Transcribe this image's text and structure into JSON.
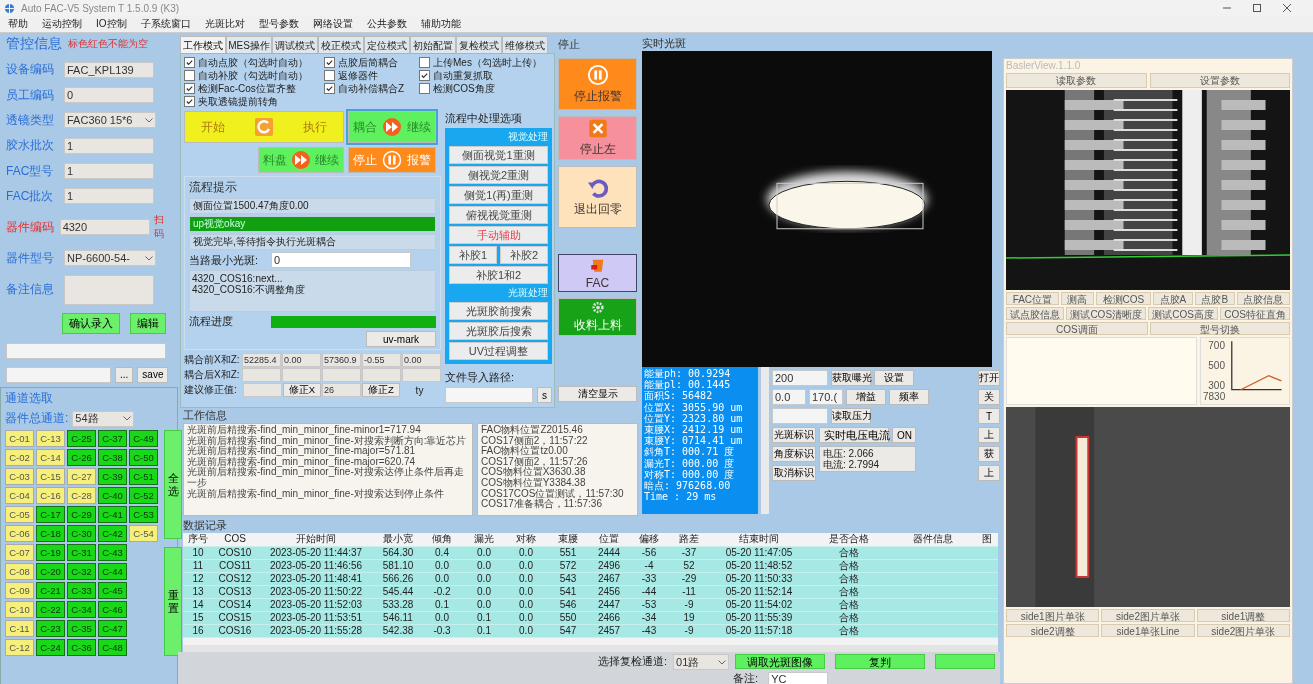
{
  "window": {
    "title": "Auto FAC-V5 System T 1.5.0.9 (K3)"
  },
  "menu": [
    "帮助",
    "运动控制",
    "IO控制",
    "子系统窗口",
    "光斑比对",
    "型号参数",
    "网络设置",
    "公共参数",
    "辅助功能"
  ],
  "left_panel": {
    "title": "管控信息",
    "note": "标色红色不能为空",
    "fields": [
      {
        "label": "设备编码",
        "kind": "text",
        "value": "FAC_KPL139",
        "required": false
      },
      {
        "label": "员工编码",
        "kind": "text",
        "value": "0",
        "required": false
      },
      {
        "label": "透镜类型",
        "kind": "combo",
        "value": "FAC360  15*6",
        "required": false
      },
      {
        "label": "胶水批次",
        "kind": "text",
        "value": "1",
        "required": false
      },
      {
        "label": "FAC型号",
        "kind": "text",
        "value": "1",
        "required": false
      },
      {
        "label": "FAC批次",
        "kind": "text",
        "value": "1",
        "required": false
      },
      {
        "label": "器件编码",
        "kind": "text",
        "value": "4320",
        "required": true,
        "link": "扫码"
      },
      {
        "label": "器件型号",
        "kind": "combo",
        "value": "NP-6600-54-",
        "required": false
      },
      {
        "label": "备注信息",
        "kind": "textarea",
        "required": false
      }
    ],
    "buttons": [
      "确认录入",
      "编辑"
    ],
    "path_buttons": [
      "...",
      "save"
    ]
  },
  "channel_panel": {
    "title": "通道选取",
    "total_label": "器件总通道:",
    "total_value": "54路",
    "channels": [
      {
        "label": "C-01",
        "selected": false
      },
      {
        "label": "C-02",
        "selected": false
      },
      {
        "label": "C-03",
        "selected": false
      },
      {
        "label": "C-04",
        "selected": false
      },
      {
        "label": "C-05",
        "selected": false
      },
      {
        "label": "C-06",
        "selected": false
      },
      {
        "label": "C-07",
        "selected": false
      },
      {
        "label": "C-08",
        "selected": false
      },
      {
        "label": "C-09",
        "selected": false
      },
      {
        "label": "C-10",
        "selected": false
      },
      {
        "label": "C-11",
        "selected": false
      },
      {
        "label": "C-12",
        "selected": false
      },
      {
        "label": "C-13",
        "selected": false
      },
      {
        "label": "C-14",
        "selected": false
      },
      {
        "label": "C-15",
        "selected": false
      },
      {
        "label": "C-16",
        "selected": false
      },
      {
        "label": "C-17",
        "selected": true
      },
      {
        "label": "C-18",
        "selected": true
      },
      {
        "label": "C-19",
        "selected": true
      },
      {
        "label": "C-20",
        "selected": true
      },
      {
        "label": "C-21",
        "selected": true
      },
      {
        "label": "C-22",
        "selected": true
      },
      {
        "label": "C-23",
        "selected": true
      },
      {
        "label": "C-24",
        "selected": true
      },
      {
        "label": "C-25",
        "selected": true
      },
      {
        "label": "C-26",
        "selected": true
      },
      {
        "label": "C-27",
        "selected": false
      },
      {
        "label": "C-28",
        "selected": false
      },
      {
        "label": "C-29",
        "selected": true
      },
      {
        "label": "C-30",
        "selected": true
      },
      {
        "label": "C-31",
        "selected": true
      },
      {
        "label": "C-32",
        "selected": true
      },
      {
        "label": "C-33",
        "selected": true
      },
      {
        "label": "C-34",
        "selected": true
      },
      {
        "label": "C-35",
        "selected": true
      },
      {
        "label": "C-36",
        "selected": true
      },
      {
        "label": "C-37",
        "selected": true
      },
      {
        "label": "C-38",
        "selected": true
      },
      {
        "label": "C-39",
        "selected": true
      },
      {
        "label": "C-40",
        "selected": true
      },
      {
        "label": "C-41",
        "selected": true
      },
      {
        "label": "C-42",
        "selected": true
      },
      {
        "label": "C-43",
        "selected": true
      },
      {
        "label": "C-44",
        "selected": true
      },
      {
        "label": "C-45",
        "selected": true
      },
      {
        "label": "C-46",
        "selected": true
      },
      {
        "label": "C-47",
        "selected": true
      },
      {
        "label": "C-48",
        "selected": true
      },
      {
        "label": "C-49",
        "selected": true
      },
      {
        "label": "C-50",
        "selected": true
      },
      {
        "label": "C-51",
        "selected": true
      },
      {
        "label": "C-52",
        "selected": true
      },
      {
        "label": "C-53",
        "selected": true
      },
      {
        "label": "C-54",
        "selected": false
      }
    ],
    "side_buttons": [
      "全选",
      "重置"
    ]
  },
  "mode_panel": {
    "tabs": [
      {
        "label": "工作模式",
        "selected": true
      },
      {
        "label": "MES操作",
        "selected": false
      },
      {
        "label": "调试模式",
        "selected": false
      },
      {
        "label": "校正模式",
        "selected": false
      },
      {
        "label": "定位模式",
        "selected": false
      },
      {
        "label": "初始配置",
        "selected": false
      },
      {
        "label": "复检模式",
        "selected": false
      },
      {
        "label": "维修模式",
        "selected": false
      }
    ],
    "checkbox_columns": [
      [
        {
          "label": "自动点胶（勾选时自动）",
          "checked": true
        },
        {
          "label": "自动补胶（勾选时自动）",
          "checked": false
        },
        {
          "label": "检测Fac-Cos位置齐整",
          "checked": true
        },
        {
          "label": "夹取透镜提前转角",
          "checked": true
        }
      ],
      [
        {
          "label": "点胶后简耦合",
          "checked": true
        },
        {
          "label": "返修器件",
          "checked": false
        },
        {
          "label": "自动补偿耦合Z",
          "checked": true
        }
      ],
      [
        {
          "label": "上传Mes（勾选时上传）",
          "checked": false
        },
        {
          "label": "自动重复抓取",
          "checked": true
        },
        {
          "label": "检测COS角度",
          "checked": false
        }
      ]
    ],
    "action_buttons": [
      {
        "left": "开始",
        "right": "执行",
        "color": "#f0f01e",
        "kind": "refresh"
      },
      {
        "left": "耦合",
        "right": "继续",
        "color": "#5ef05e",
        "kind": "forward"
      },
      {
        "left": "料盘",
        "right": "继续",
        "color": "#5ef05e",
        "kind": "forward"
      },
      {
        "left": "停止",
        "right": "报警",
        "color": "#ff8a1c",
        "kind": "pause"
      }
    ],
    "hints": {
      "title": "流程提示",
      "lines": [
        {
          "text": "侧面位置1500.47角度0.00",
          "kind": "normal"
        },
        {
          "text": "up视觉okay",
          "kind": "ok"
        },
        {
          "text": "视觉完毕,等待指令执行光斑耦合",
          "kind": "normal"
        }
      ],
      "min_spot_label": "当路最小光斑:",
      "min_spot_value": "0",
      "log": [
        "4320_COS16:next...",
        "4320_COS16:不调整角度"
      ],
      "progress_label": "流程进度",
      "progress": {
        "level": 1
      },
      "mark_button": "uv-mark"
    },
    "coupling": [
      {
        "label": "耦合前X和Z:",
        "cells": [
          {
            "kind": "field",
            "value": "52285.4"
          },
          {
            "kind": "field",
            "value": "0.00"
          },
          {
            "kind": "field",
            "value": "57360.9"
          },
          {
            "kind": "field",
            "value": "-0.55"
          },
          {
            "kind": "field",
            "value": "0.00"
          }
        ]
      },
      {
        "label": "耦合后X和Z:",
        "cells": [
          {
            "kind": "field"
          },
          {
            "kind": "field"
          },
          {
            "kind": "field"
          },
          {
            "kind": "field"
          },
          {
            "kind": "field"
          }
        ]
      },
      {
        "label": "建议修正值:",
        "cells": [
          {
            "kind": "field"
          },
          {
            "kind": "button",
            "value": "修正X"
          },
          {
            "kind": "field",
            "value": "26"
          },
          {
            "kind": "button",
            "value": "修正Z"
          },
          {
            "kind": "text",
            "value": "ty"
          }
        ]
      }
    ],
    "options": {
      "title": "流程中处理选项",
      "sections": [
        {
          "title": "视觉处理",
          "rows": [
            [
              {
                "label": "侧面视觉1重测",
                "kind": "normal"
              }
            ],
            [
              {
                "label": "侧视觉2重测",
                "kind": "normal"
              }
            ],
            [
              {
                "label": "侧觉1(再)重测",
                "kind": "normal"
              }
            ],
            [
              {
                "label": "俯视视觉重测",
                "kind": "normal"
              }
            ],
            [
              {
                "label": "手动辅助",
                "kind": "alert"
              }
            ],
            [
              {
                "label": "补胶1",
                "kind": "normal"
              },
              {
                "label": "补胶2",
                "kind": "normal"
              }
            ],
            [
              {
                "label": "补胶1和2",
                "kind": "normal"
              }
            ]
          ]
        },
        {
          "title": "光斑处理",
          "rows": [
            [
              {
                "label": "光斑胶前搜索",
                "kind": "normal"
              }
            ],
            [
              {
                "label": "光斑胶后搜索",
                "kind": "normal"
              }
            ],
            [
              {
                "label": "UV过程调整",
                "kind": "normal"
              }
            ]
          ]
        }
      ],
      "path_label": "文件导入路径:",
      "path_button": "s"
    }
  },
  "stop_panel": {
    "title": "停止",
    "buttons": [
      {
        "label": "停止报警",
        "color": "#ff8a1c",
        "kind": "pause"
      },
      {
        "label": "停止左",
        "color": "#f5909c",
        "kind": "cross"
      },
      {
        "label": "退出回零",
        "color": "#fde2bb",
        "kind": "undo"
      },
      {
        "label": "FAC",
        "color": "#cfcaf5",
        "kind": "bucket"
      },
      {
        "label": "收料上料",
        "color": "#17a317",
        "kind": "gear"
      }
    ],
    "clear_button": "清空显示"
  },
  "work_info": {
    "title": "工作信息",
    "log": [
      "光斑前后精搜索-find_min_minor_fine-minor1=717.94",
      "光斑前后精搜索-find_min_minor_fine-对搜索判断方向:靠近芯片",
      "光斑前后精搜索-find_min_minor_fine-major=571.81",
      "光斑前后精搜索-find_min_minor_fine-major=620.74",
      "光斑前后精搜索-find_min_minor_fine-对搜索达停止条件后再走一步",
      "光斑前后精搜索-find_min_minor_fine-对搜索达到停止条件"
    ],
    "status_log": [
      "FAC物料位置Z2015.46",
      "COS17侧面2，11:57:22",
      "FAC物料位置tz0.00",
      "COS17侧面2，11:57:26",
      "COS物料位置X3630.38",
      "COS物料位置Y3384.38",
      "COS17COS位置测试，11:57:30",
      "COS17准备耦合，11:57:36"
    ]
  },
  "live_spot": {
    "title": "实时光斑",
    "readout": [
      "能量ph: 00.9294",
      "能量pl: 00.1445",
      "面积S: 56482",
      "位置X: 3055.90 um",
      "位置Y: 2323.80 um",
      "束腰X: 2412.19 um",
      "束腰Y: 0714.41 um",
      "斜角T: 000.71  度",
      "漏光T: 000.00  度",
      "对称T: 000.00  度",
      "暗点: 976268.00",
      "Time : 29  ms"
    ],
    "exposure": "200",
    "get_exposure": "获取曝光",
    "set": "设置",
    "gain_min": "0.0",
    "gain_max": "170.(",
    "gain": "增益",
    "frequency": "频率",
    "read_pressure": "读取压力",
    "mark_buttons": [
      "光斑标识",
      "角度标识",
      "取消标识"
    ],
    "power_button": "实时电压电流",
    "power_state": "ON",
    "voltage": "电压: 2.066",
    "current": "电流: 2.7994",
    "side_buttons": [
      "打开",
      "关",
      "T",
      "上",
      "获",
      "上"
    ]
  },
  "data_records": {
    "title": "数据记录",
    "columns": [
      "序号",
      "COS",
      "开始时间",
      "最小宽",
      "倾角",
      "漏光",
      "对称",
      "束腰",
      "位置",
      "偏移",
      "路差",
      "结束时间",
      "是否合格",
      "器件信息",
      "图"
    ],
    "rows": [
      [
        "10",
        "COS10",
        "2023-05-20 11:44:37",
        "564.30",
        "0.4",
        "0.0",
        "0.0",
        "551",
        "2444",
        "-56",
        "-37",
        "05-20 11:47:05",
        "合格"
      ],
      [
        "11",
        "COS11",
        "2023-05-20 11:46:56",
        "581.10",
        "0.0",
        "0.0",
        "0.0",
        "572",
        "2496",
        "-4",
        "52",
        "05-20 11:48:52",
        "合格"
      ],
      [
        "12",
        "COS12",
        "2023-05-20 11:48:41",
        "566.26",
        "0.0",
        "0.0",
        "0.0",
        "543",
        "2467",
        "-33",
        "-29",
        "05-20 11:50:33",
        "合格"
      ],
      [
        "13",
        "COS13",
        "2023-05-20 11:50:22",
        "545.44",
        "-0.2",
        "0.0",
        "0.0",
        "541",
        "2456",
        "-44",
        "-11",
        "05-20 11:52:14",
        "合格"
      ],
      [
        "14",
        "COS14",
        "2023-05-20 11:52:03",
        "533.28",
        "0.1",
        "0.0",
        "0.0",
        "546",
        "2447",
        "-53",
        "-9",
        "05-20 11:54:02",
        "合格"
      ],
      [
        "15",
        "COS15",
        "2023-05-20 11:53:51",
        "546.11",
        "0.0",
        "0.1",
        "0.0",
        "550",
        "2466",
        "-34",
        "19",
        "05-20 11:55:39",
        "合格"
      ],
      [
        "16",
        "COS16",
        "2023-05-20 11:55:28",
        "542.38",
        "-0.3",
        "0.1",
        "0.0",
        "547",
        "2457",
        "-43",
        "-9",
        "05-20 11:57:18",
        "合格"
      ]
    ]
  },
  "bottom_bar": {
    "channel_label": "选择复检通道:",
    "channel_value": "01路",
    "buttons": [
      "调取光斑图像",
      "复判"
    ],
    "note_label": "备注:",
    "note_value": "YC"
  },
  "basler_window": {
    "title": "BaslerView.1.1.0",
    "top_buttons": [
      "读取参数",
      "设置参数"
    ],
    "tool_buttons": [
      "FAC位置",
      "测高",
      "检测COS",
      "点胶A",
      "点胶B",
      "点胶信息",
      "试点胶信息",
      "测试COS清晰度",
      "测试COS高度",
      "COS特征直角",
      "COS调面",
      "型号切换"
    ],
    "mini_chart": {
      "y_labels": [
        "700",
        "500",
        "300"
      ],
      "x_label": "7830"
    },
    "side_buttons": [
      "side1图片单张",
      "side2图片单张",
      "side1调整",
      "side2调整",
      "side1单张Line",
      "side2图片单张"
    ]
  }
}
